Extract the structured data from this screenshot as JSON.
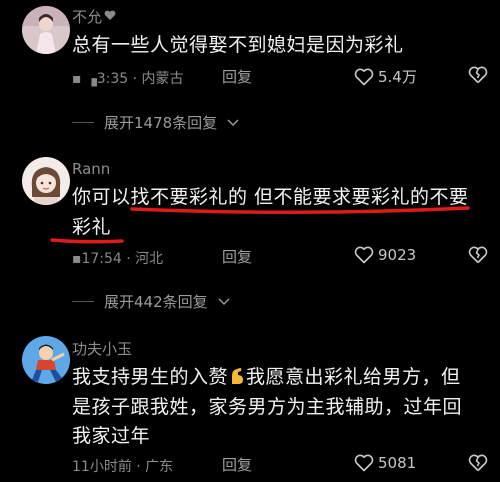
{
  "comments": [
    {
      "username": "不允",
      "content": "总有一些人觉得娶不到媳妇是因为彩礼",
      "time_location": "▪ ▗3:35 · 内蒙古",
      "reply_label": "回复",
      "likes": "5.4万",
      "expand_label": "展开1478条回复"
    },
    {
      "username": "Rann",
      "content_line1": "你可以找不要彩礼的 但不能要求要彩礼的不要",
      "content_line2": "彩礼",
      "time_location": "▪17:54 · 河北",
      "reply_label": "回复",
      "likes": "9023",
      "expand_label": "展开442条回复"
    },
    {
      "username": "功夫小玉",
      "content_line1a": "我支持男生的入赘",
      "content_line1b": "我愿意出彩礼给男方，但",
      "content_line2": "是孩子跟我姓，家务男方为主我辅助，过年回",
      "content_line3": "我家过年",
      "time_location": "11小时前 · 广东",
      "reply_label": "回复",
      "likes": "5081"
    }
  ],
  "colors": {
    "background": "#000000",
    "annotation_red": "#e01a1a"
  }
}
